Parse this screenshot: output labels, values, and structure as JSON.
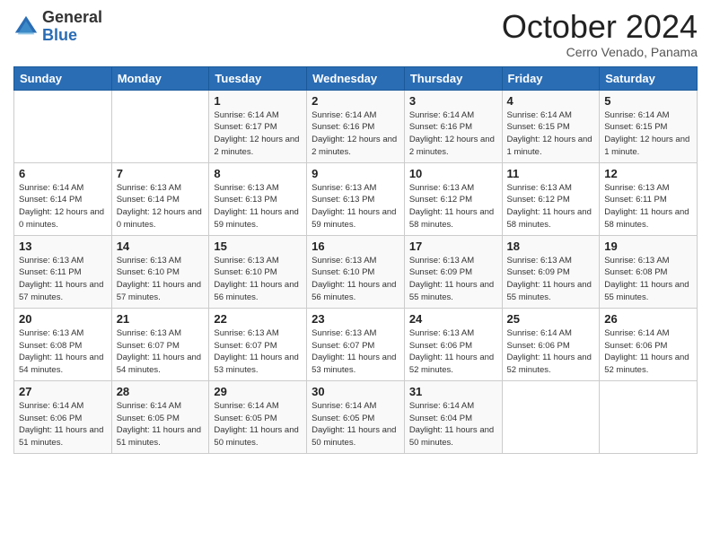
{
  "logo": {
    "general": "General",
    "blue": "Blue"
  },
  "title": "October 2024",
  "subtitle": "Cerro Venado, Panama",
  "days_of_week": [
    "Sunday",
    "Monday",
    "Tuesday",
    "Wednesday",
    "Thursday",
    "Friday",
    "Saturday"
  ],
  "weeks": [
    [
      {
        "day": "",
        "info": ""
      },
      {
        "day": "",
        "info": ""
      },
      {
        "day": "1",
        "info": "Sunrise: 6:14 AM\nSunset: 6:17 PM\nDaylight: 12 hours and 2 minutes."
      },
      {
        "day": "2",
        "info": "Sunrise: 6:14 AM\nSunset: 6:16 PM\nDaylight: 12 hours and 2 minutes."
      },
      {
        "day": "3",
        "info": "Sunrise: 6:14 AM\nSunset: 6:16 PM\nDaylight: 12 hours and 2 minutes."
      },
      {
        "day": "4",
        "info": "Sunrise: 6:14 AM\nSunset: 6:15 PM\nDaylight: 12 hours and 1 minute."
      },
      {
        "day": "5",
        "info": "Sunrise: 6:14 AM\nSunset: 6:15 PM\nDaylight: 12 hours and 1 minute."
      }
    ],
    [
      {
        "day": "6",
        "info": "Sunrise: 6:14 AM\nSunset: 6:14 PM\nDaylight: 12 hours and 0 minutes."
      },
      {
        "day": "7",
        "info": "Sunrise: 6:13 AM\nSunset: 6:14 PM\nDaylight: 12 hours and 0 minutes."
      },
      {
        "day": "8",
        "info": "Sunrise: 6:13 AM\nSunset: 6:13 PM\nDaylight: 11 hours and 59 minutes."
      },
      {
        "day": "9",
        "info": "Sunrise: 6:13 AM\nSunset: 6:13 PM\nDaylight: 11 hours and 59 minutes."
      },
      {
        "day": "10",
        "info": "Sunrise: 6:13 AM\nSunset: 6:12 PM\nDaylight: 11 hours and 58 minutes."
      },
      {
        "day": "11",
        "info": "Sunrise: 6:13 AM\nSunset: 6:12 PM\nDaylight: 11 hours and 58 minutes."
      },
      {
        "day": "12",
        "info": "Sunrise: 6:13 AM\nSunset: 6:11 PM\nDaylight: 11 hours and 58 minutes."
      }
    ],
    [
      {
        "day": "13",
        "info": "Sunrise: 6:13 AM\nSunset: 6:11 PM\nDaylight: 11 hours and 57 minutes."
      },
      {
        "day": "14",
        "info": "Sunrise: 6:13 AM\nSunset: 6:10 PM\nDaylight: 11 hours and 57 minutes."
      },
      {
        "day": "15",
        "info": "Sunrise: 6:13 AM\nSunset: 6:10 PM\nDaylight: 11 hours and 56 minutes."
      },
      {
        "day": "16",
        "info": "Sunrise: 6:13 AM\nSunset: 6:10 PM\nDaylight: 11 hours and 56 minutes."
      },
      {
        "day": "17",
        "info": "Sunrise: 6:13 AM\nSunset: 6:09 PM\nDaylight: 11 hours and 55 minutes."
      },
      {
        "day": "18",
        "info": "Sunrise: 6:13 AM\nSunset: 6:09 PM\nDaylight: 11 hours and 55 minutes."
      },
      {
        "day": "19",
        "info": "Sunrise: 6:13 AM\nSunset: 6:08 PM\nDaylight: 11 hours and 55 minutes."
      }
    ],
    [
      {
        "day": "20",
        "info": "Sunrise: 6:13 AM\nSunset: 6:08 PM\nDaylight: 11 hours and 54 minutes."
      },
      {
        "day": "21",
        "info": "Sunrise: 6:13 AM\nSunset: 6:07 PM\nDaylight: 11 hours and 54 minutes."
      },
      {
        "day": "22",
        "info": "Sunrise: 6:13 AM\nSunset: 6:07 PM\nDaylight: 11 hours and 53 minutes."
      },
      {
        "day": "23",
        "info": "Sunrise: 6:13 AM\nSunset: 6:07 PM\nDaylight: 11 hours and 53 minutes."
      },
      {
        "day": "24",
        "info": "Sunrise: 6:13 AM\nSunset: 6:06 PM\nDaylight: 11 hours and 52 minutes."
      },
      {
        "day": "25",
        "info": "Sunrise: 6:14 AM\nSunset: 6:06 PM\nDaylight: 11 hours and 52 minutes."
      },
      {
        "day": "26",
        "info": "Sunrise: 6:14 AM\nSunset: 6:06 PM\nDaylight: 11 hours and 52 minutes."
      }
    ],
    [
      {
        "day": "27",
        "info": "Sunrise: 6:14 AM\nSunset: 6:06 PM\nDaylight: 11 hours and 51 minutes."
      },
      {
        "day": "28",
        "info": "Sunrise: 6:14 AM\nSunset: 6:05 PM\nDaylight: 11 hours and 51 minutes."
      },
      {
        "day": "29",
        "info": "Sunrise: 6:14 AM\nSunset: 6:05 PM\nDaylight: 11 hours and 50 minutes."
      },
      {
        "day": "30",
        "info": "Sunrise: 6:14 AM\nSunset: 6:05 PM\nDaylight: 11 hours and 50 minutes."
      },
      {
        "day": "31",
        "info": "Sunrise: 6:14 AM\nSunset: 6:04 PM\nDaylight: 11 hours and 50 minutes."
      },
      {
        "day": "",
        "info": ""
      },
      {
        "day": "",
        "info": ""
      }
    ]
  ]
}
